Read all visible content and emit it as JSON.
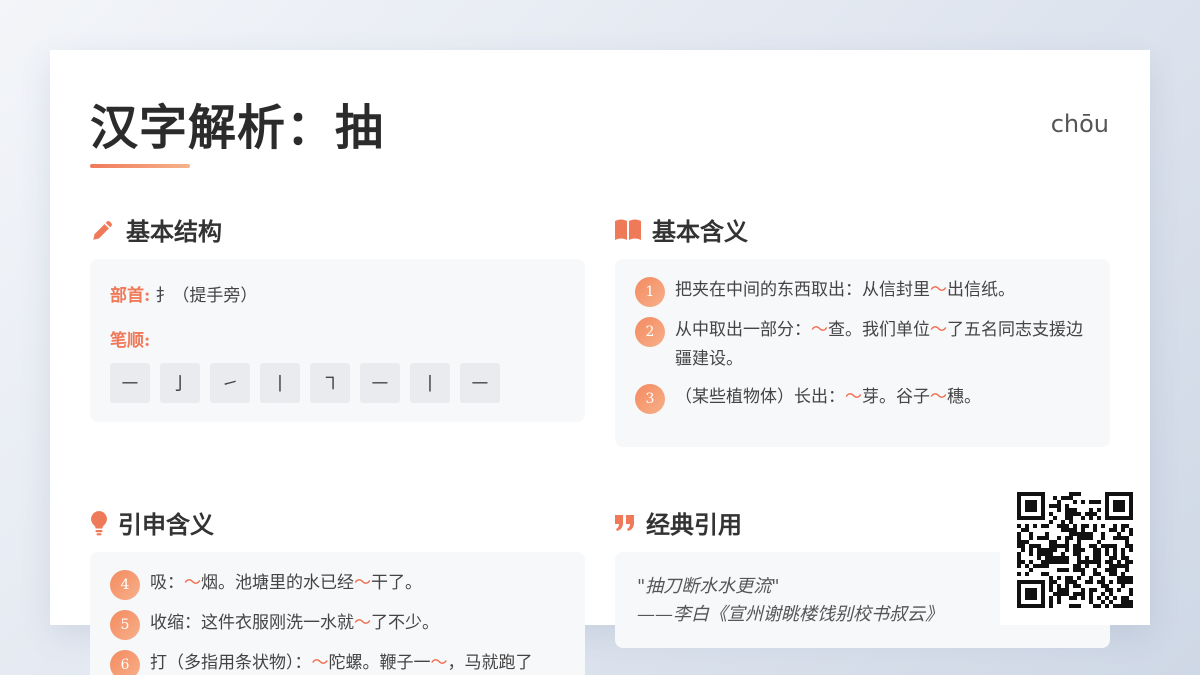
{
  "header": {
    "title": "汉字解析：抽",
    "pinyin": "chōu"
  },
  "structure": {
    "heading": "基本结构",
    "icon": "pencil-icon",
    "radical_label": "部首:",
    "radical_value": "扌（提手旁）",
    "strokes_label": "笔顺:",
    "strokes": [
      "㇐",
      "亅",
      "㇀",
      "丨",
      "㇕",
      "㇐",
      "丨",
      "㇐"
    ]
  },
  "basic_meanings": {
    "heading": "基本含义",
    "icon": "open-book-icon",
    "items": [
      {
        "num": "1",
        "parts": [
          "把夹在中间的东西取出：从信封里",
          "出信纸。"
        ]
      },
      {
        "num": "2",
        "parts": [
          "从中取出一部分：",
          "查。我们单位",
          "了五名同志支援边疆建设。"
        ]
      },
      {
        "num": "3",
        "parts": [
          "（某些植物体）长出：",
          "芽。谷子",
          "穗。"
        ]
      }
    ]
  },
  "extended_meanings": {
    "heading": "引申含义",
    "icon": "lightbulb-icon",
    "items": [
      {
        "num": "4",
        "parts": [
          "吸：",
          "烟。池塘里的水已经",
          "干了。"
        ]
      },
      {
        "num": "5",
        "parts": [
          "收缩：这件衣服刚洗一水就",
          "了不少。"
        ]
      },
      {
        "num": "6",
        "parts": [
          "打（多指用条状物）：",
          "陀螺。鞭子一",
          "，马就跑了"
        ]
      }
    ]
  },
  "classic_quote": {
    "heading": "经典引用",
    "icon": "quote-icon",
    "line1": "\"抽刀断水水更流\"",
    "line2": "——李白《宣州谢眺楼饯别校书叔云》"
  },
  "tilde": "～",
  "colors": {
    "accent": "#ef7a5a",
    "panel": "#f7f8fa",
    "stroke_box": "#e9ebee"
  }
}
